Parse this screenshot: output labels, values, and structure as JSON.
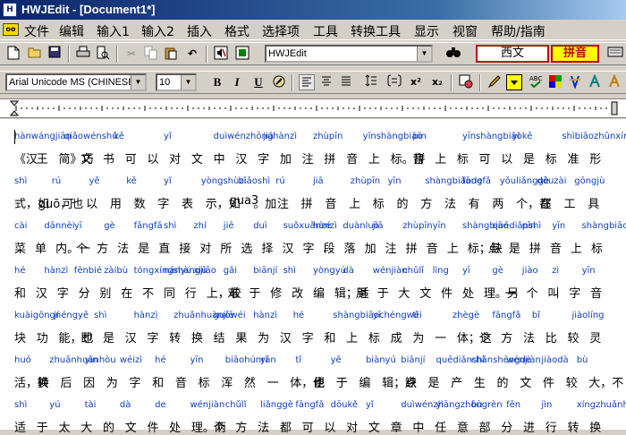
{
  "window": {
    "title": "HWJEdit - [Document1*]"
  },
  "menu": {
    "icon": "app-menu-icon",
    "items": [
      "文件",
      "编辑",
      "输入1",
      "输入2",
      "插入",
      "格式",
      "选择项",
      "工具",
      "转换工具",
      "显示",
      "视窗",
      "帮助/指南"
    ]
  },
  "toolbar1": {
    "font_preset": "HWJEdit",
    "mode_west": "西文",
    "mode_pinyin": "拼音"
  },
  "toolbar2": {
    "font_name": "Arial Unicode MS (CHINESE_",
    "font_size": "10",
    "bold": "B",
    "italic": "I",
    "underline": "U",
    "superscript": "x²",
    "subscript": "x₂"
  },
  "editor": {
    "lines": [
      {
        "pinyin": [
          "hànwángjiān",
          "qiǎowénshū",
          "kě",
          "yǐ",
          "duìwénzhōnghànzì",
          "jiā",
          "zhùpīn",
          "yīnshàngbiāo",
          "pīn",
          "yīnshàngbiāokě",
          "yǐ",
          "shìbiāozhǔnxíng"
        ],
        "hanzi": [
          "《汉",
          "王",
          "简》巧",
          "文",
          "书",
          "可",
          "以",
          "对",
          "文",
          "中",
          "汉",
          "字",
          "加",
          "注",
          "拼",
          "音",
          "上",
          "标。拼",
          "音",
          "上",
          "标",
          "可",
          "以",
          "是",
          "标",
          "准",
          "形"
        ]
      },
      {
        "pinyin": [
          "shì",
          "rú",
          "yě",
          "kě",
          "yǐ",
          "yòngshùzì",
          "biǎoshì",
          "rú",
          "jiā",
          "zhùpīn",
          "yīn",
          "shàngbiāode",
          "fāngfǎ",
          "yǒuliǎnggè",
          "dōuzài",
          "gōngjù"
        ],
        "hanzi": [
          "式，如",
          "guō，也",
          "可",
          "以",
          "用",
          "数",
          "字",
          "表",
          "示，如",
          "gua3",
          "。加",
          "注",
          "拼",
          "音",
          "上",
          "标",
          "的",
          "方",
          "法",
          "有",
          "两",
          "个，都",
          "在",
          "工",
          "具"
        ]
      },
      {
        "pinyin": [
          "cài",
          "dānnèi",
          "yī",
          "gè",
          "fāngfǎ",
          "shì",
          "zhí",
          "jiē",
          "duì",
          "suǒxuǎnzé",
          "hànzì",
          "duànluò",
          "jiā",
          "zhùpīn",
          "yīn",
          "shàngbiāo",
          "quēdiǎnshì",
          "pīn",
          "yīn",
          "shàngbiāo"
        ],
        "hanzi": [
          "菜",
          "单",
          "内。一",
          "个",
          "方",
          "法",
          "是",
          "直",
          "接",
          "对",
          "所",
          "选",
          "择",
          "汉",
          "字",
          "段",
          "落",
          "加",
          "注",
          "拼",
          "音",
          "上",
          "标；缺",
          "点",
          "是",
          "拼",
          "音",
          "上",
          "标"
        ]
      },
      {
        "pinyin": [
          "hé",
          "hànzì",
          "fēnbié",
          "zàibù",
          "tóngxíngshàngjiāo",
          "nányú",
          "xiū",
          "gǎi",
          "biānjí",
          "shì",
          "yòngyú",
          "dà",
          "wénjiàn",
          "chǔlǐ",
          "lìng",
          "yī",
          "gè",
          "jiào",
          "zì",
          "yīn"
        ],
        "hanzi": [
          "和",
          "汉",
          "字",
          "分",
          "别",
          "在",
          "不",
          "同",
          "行",
          "上，较",
          "难",
          "于",
          "修",
          "改",
          "编",
          "辑；适",
          "用",
          "于",
          "大",
          "文",
          "件",
          "处",
          "理。另",
          "一",
          "个",
          "叫",
          "字",
          "音"
        ]
      },
      {
        "pinyin": [
          "kuàigōngnéngyě",
          "jí",
          "shì",
          "hànzì",
          "zhuǎnhuànjiē",
          "guǒwéi",
          "hànzì",
          "hé",
          "shàngbiāochéngwèi",
          "yī",
          "tǐ",
          "zhègè",
          "fāngfǎ",
          "bǐ",
          "jiàolíng"
        ],
        "hanzi": [
          "块",
          "功",
          "能，也",
          "即",
          "是",
          "汉",
          "字",
          "转",
          "换",
          "结",
          "果",
          "为",
          "汉",
          "字",
          "和",
          "上",
          "标",
          "成",
          "为",
          "一",
          "体；这",
          "个",
          "方",
          "法",
          "比",
          "较",
          "灵"
        ]
      },
      {
        "pinyin": [
          "huó",
          "zhuǎnhuànhòu",
          "yīn",
          "wéizì",
          "hé",
          "yīn",
          "biāohúnrán",
          "yī",
          "tǐ",
          "yě",
          "biànyú",
          "biānjí",
          "quēdiǎnshì",
          "chǎnshēngde",
          "wénjiàn",
          "jiàodà",
          "bù"
        ],
        "hanzi": [
          "活，转",
          "换",
          "后",
          "因",
          "为",
          "字",
          "和",
          "音",
          "标",
          "浑",
          "然",
          "一",
          "体，也",
          "便",
          "于",
          "编",
          "辑；缺",
          "点",
          "是",
          "产",
          "生",
          "的",
          "文",
          "件",
          "较",
          "大，不"
        ]
      },
      {
        "pinyin": [
          "shì",
          "yú",
          "tài",
          "dà",
          "de",
          "wénjiàn",
          "chǔlǐ",
          "liǎnggè",
          "fāngfǎ",
          "dōukě",
          "yǐ",
          "duìwénzhāngzhōngrèn",
          "yì",
          "bù",
          "fēn",
          "jìn",
          "xíngzhuǎnhuàn"
        ],
        "hanzi": [
          "适",
          "于",
          "太",
          "大",
          "的",
          "文",
          "件",
          "处",
          "理。两",
          "个",
          "方",
          "法",
          "都",
          "可",
          "以",
          "对",
          "文",
          "章",
          "中",
          "任",
          "意",
          "部",
          "分",
          "进",
          "行",
          "转",
          "换"
        ]
      }
    ]
  },
  "colors": {
    "titlebar": "#0a246a",
    "pinyin": "#1040c0",
    "mode_west_border": "#c00000",
    "mode_pinyin_bg": "#ffff00"
  }
}
